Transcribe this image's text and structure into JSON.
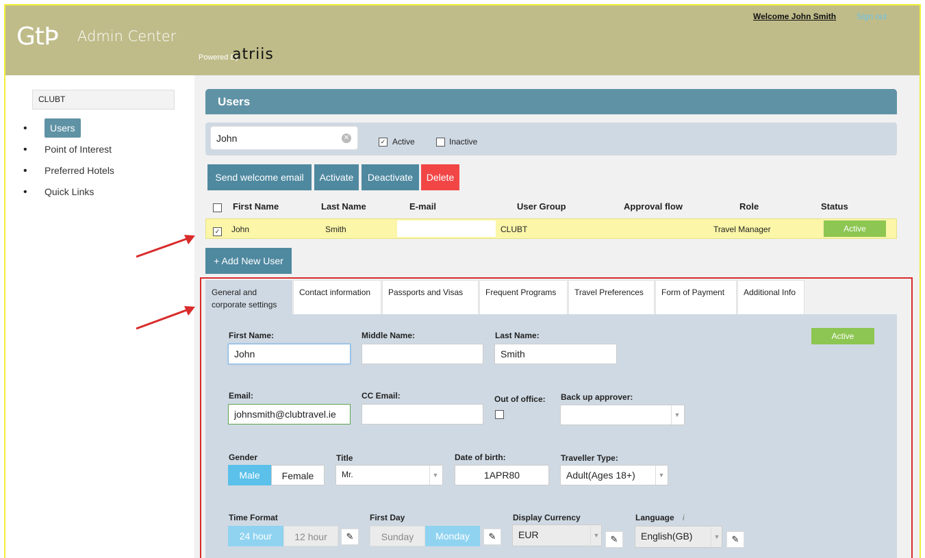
{
  "header": {
    "logo_mark": "GtϷ",
    "logo_text": "Admin Center",
    "powered_by": "Powered By",
    "brand": "atriis",
    "welcome": "Welcome John Smith",
    "sign_out": "Sign out"
  },
  "sidebar": {
    "company": "CLUBT",
    "items": [
      {
        "label": "Users",
        "active": true
      },
      {
        "label": "Point of Interest",
        "active": false
      },
      {
        "label": "Preferred Hotels",
        "active": false
      },
      {
        "label": "Quick Links",
        "active": false
      }
    ]
  },
  "users": {
    "title": "Users",
    "search_value": "John",
    "filter_active_label": "Active",
    "filter_active_checked": true,
    "filter_inactive_label": "Inactive",
    "filter_inactive_checked": false,
    "buttons": {
      "send_welcome": "Send welcome email",
      "activate": "Activate",
      "deactivate": "Deactivate",
      "delete": "Delete",
      "add_new_user": "Add New User"
    },
    "columns": [
      "First Name",
      "Last Name",
      "E-mail",
      "User Group",
      "Approval flow",
      "Role",
      "Status"
    ],
    "rows": [
      {
        "first": "John",
        "last": "Smith",
        "email": "",
        "group": "CLUBT",
        "approval": "",
        "role": "Travel Manager",
        "status": "Active",
        "checked": true
      }
    ]
  },
  "tabs": [
    {
      "label": "General and corporate settings",
      "active": true
    },
    {
      "label": "Contact information",
      "active": false
    },
    {
      "label": "Passports and Visas",
      "active": false
    },
    {
      "label": "Frequent Programs",
      "active": false
    },
    {
      "label": "Travel Preferences",
      "active": false
    },
    {
      "label": "Form of Payment",
      "active": false
    },
    {
      "label": "Additional Info",
      "active": false
    }
  ],
  "form": {
    "status_badge": "Active",
    "first_name_label": "First Name:",
    "first_name": "John",
    "middle_name_label": "Middle Name:",
    "middle_name": "",
    "last_name_label": "Last Name:",
    "last_name": "Smith",
    "email_label": "Email:",
    "email": "johnsmith@clubtravel.ie",
    "cc_email_label": "CC Email:",
    "cc_email": "",
    "out_of_office_label": "Out of office:",
    "backup_approver_label": "Back up approver:",
    "backup_approver": "",
    "gender_label": "Gender",
    "gender_male": "Male",
    "gender_female": "Female",
    "gender_selected": "Male",
    "title_label": "Title",
    "title_value": "Mr.",
    "dob_label": "Date of birth:",
    "dob_value": "1APR80",
    "traveller_type_label": "Traveller Type:",
    "traveller_type": "Adult(Ages 18+)",
    "time_format_label": "Time Format",
    "time_24": "24 hour",
    "time_12": "12 hour",
    "time_selected": "24 hour",
    "first_day_label": "First Day",
    "first_day_sunday": "Sunday",
    "first_day_monday": "Monday",
    "first_day_selected": "Monday",
    "currency_label": "Display Currency",
    "currency_value": "EUR",
    "language_label": "Language",
    "language_info": "i",
    "language_value": "English(GB)"
  },
  "colors": {
    "header_bg": "#bfbc8a",
    "accent": "#5f92a5",
    "delete_red": "#f24646",
    "active_green": "#8dc652",
    "highlight_row": "#fbf6a8",
    "annotation_red": "#d92b2b"
  }
}
